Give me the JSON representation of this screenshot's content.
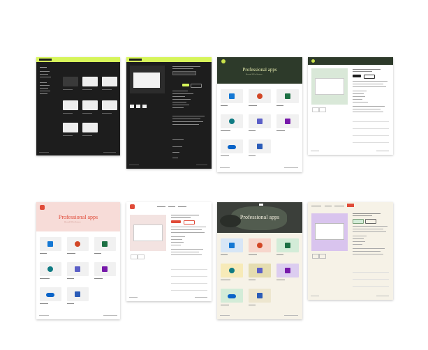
{
  "hero": {
    "title": "Professional apps",
    "subtitle": "Microsoft 365 for Business"
  },
  "colors": {
    "lime": "#d6f55a",
    "dark_bg": "#1d1d1d",
    "forest": "#2d3a2a",
    "pink_bg": "#f7dcd8",
    "cream": "#f6f2e7",
    "red_accent": "#e04b39",
    "lavender": "#d9c4ee",
    "mint": "#d9e8d8"
  },
  "apps": [
    {
      "name": "Outlook",
      "icon": "outlook-icon",
      "color": "#1478d4"
    },
    {
      "name": "PowerPoint",
      "icon": "powerpoint-icon",
      "color": "#d24726"
    },
    {
      "name": "Excel",
      "icon": "excel-icon",
      "color": "#1d7044"
    },
    {
      "name": "SharePoint",
      "icon": "sharepoint-icon",
      "color": "#0f7b83"
    },
    {
      "name": "Teams",
      "icon": "teams-icon",
      "color": "#5b5fc7"
    },
    {
      "name": "OneNote",
      "icon": "onenote-icon",
      "color": "#7719aa"
    },
    {
      "name": "OneDrive",
      "icon": "onedrive-icon",
      "color": "#0a64c8"
    },
    {
      "name": "Word",
      "icon": "word-icon",
      "color": "#2b5cb8"
    }
  ]
}
